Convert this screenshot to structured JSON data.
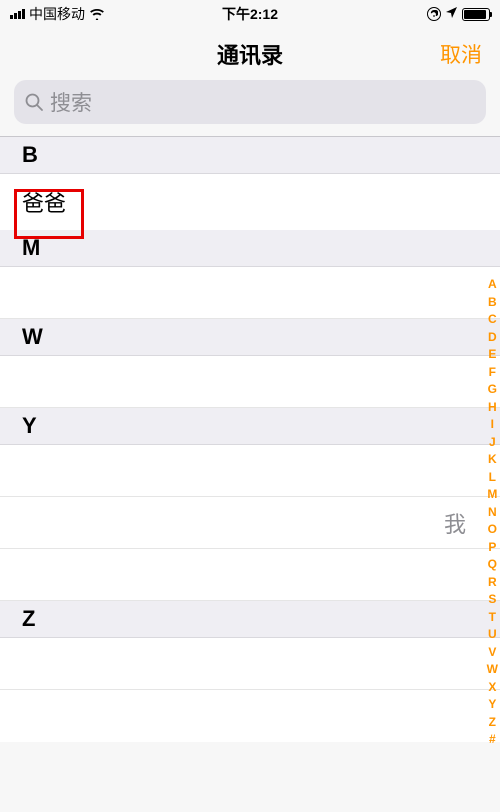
{
  "statusBar": {
    "carrier": "中国移动",
    "time": "下午2:12"
  },
  "nav": {
    "title": "通讯录",
    "cancel": "取消"
  },
  "search": {
    "placeholder": "搜索"
  },
  "sections": {
    "b": {
      "header": "B",
      "contact": "爸爸"
    },
    "m": {
      "header": "M"
    },
    "w": {
      "header": "W"
    },
    "y": {
      "header": "Y",
      "me": "我"
    },
    "z": {
      "header": "Z"
    }
  },
  "indexBar": {
    "A": "A",
    "B": "B",
    "C": "C",
    "D": "D",
    "E": "E",
    "F": "F",
    "G": "G",
    "H": "H",
    "I": "I",
    "J": "J",
    "K": "K",
    "L": "L",
    "M": "M",
    "N": "N",
    "O": "O",
    "P": "P",
    "Q": "Q",
    "R": "R",
    "S": "S",
    "T": "T",
    "U": "U",
    "V": "V",
    "W": "W",
    "X": "X",
    "Y": "Y",
    "Z": "Z",
    "hash": "#"
  }
}
